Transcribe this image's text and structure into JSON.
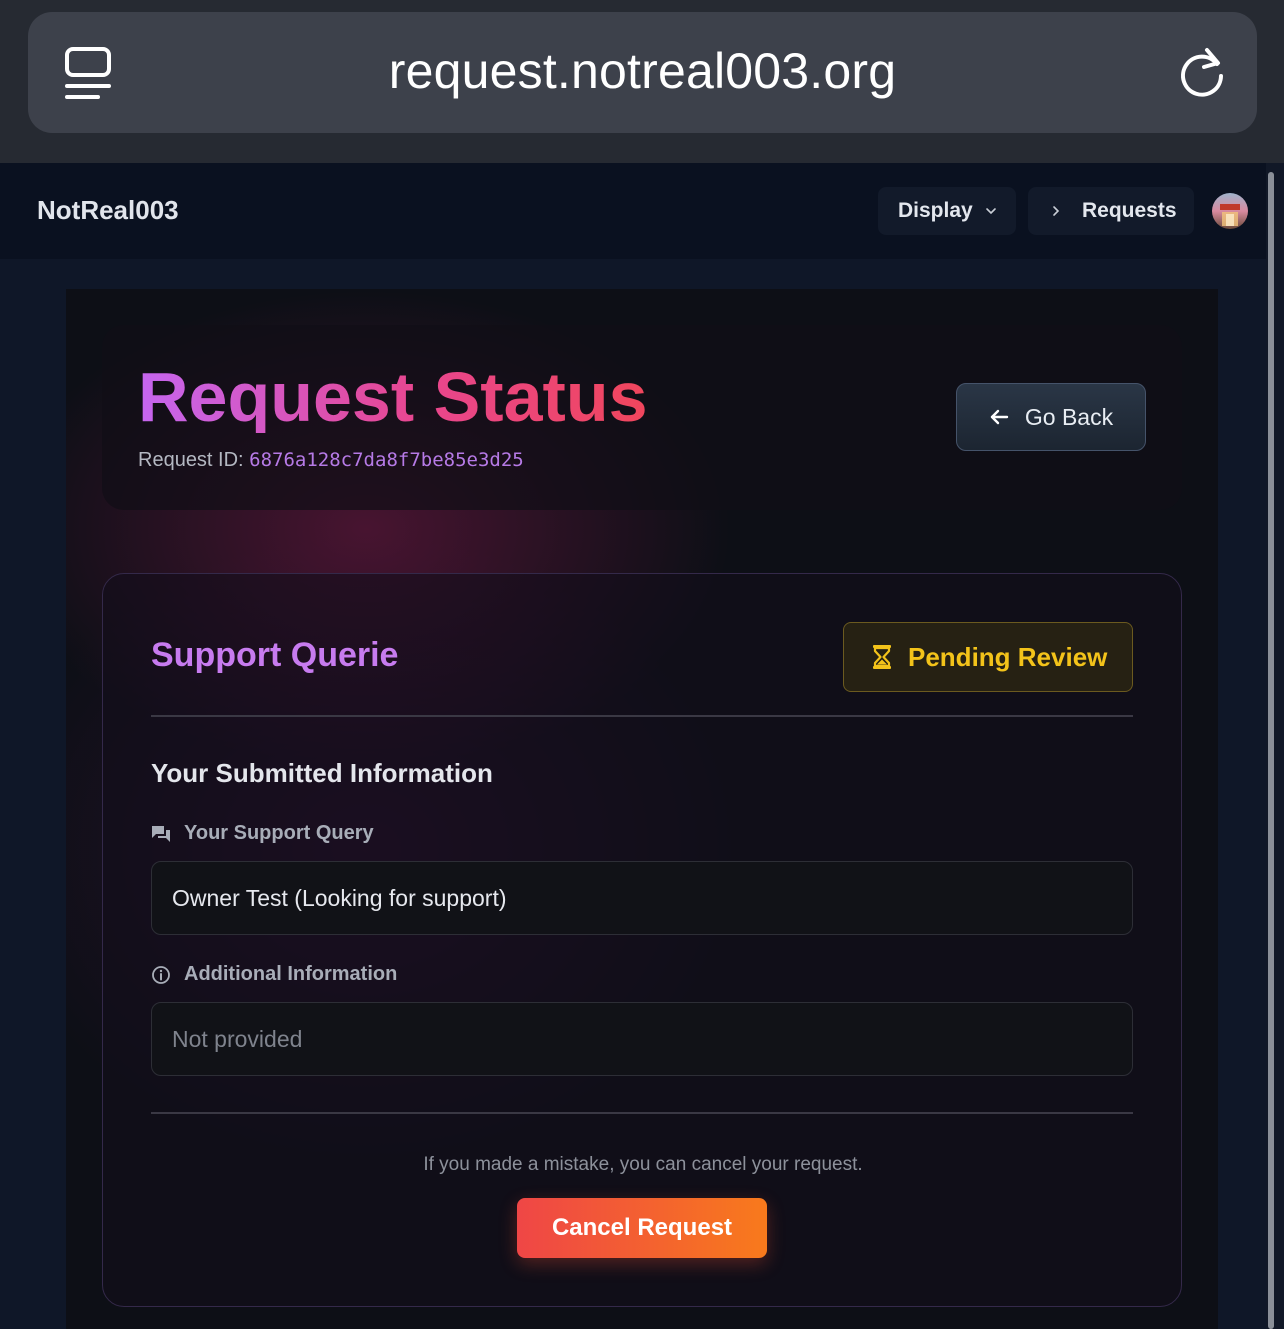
{
  "browser": {
    "url": "request.notreal003.org"
  },
  "nav": {
    "brand": "NotReal003",
    "display_label": "Display",
    "requests_label": "Requests"
  },
  "header": {
    "title": "Request Status",
    "request_id_label": "Request ID:",
    "request_id_value": "6876a128c7da8f7be85e3d25",
    "go_back_label": "Go Back"
  },
  "request": {
    "type_title": "Support Querie",
    "status": "Pending Review",
    "section_heading": "Your Submitted Information",
    "query_label": "Your Support Query",
    "query_value": "Owner Test (Looking for support)",
    "info_label": "Additional Information",
    "info_value": "Not provided",
    "cancel_note": "If you made a mistake, you can cancel your request.",
    "cancel_label": "Cancel Request"
  },
  "colors": {
    "accent_purple": "#c77bef",
    "status_pending": "#f3c31a",
    "cancel_start": "#ef4646",
    "cancel_end": "#f87a1c"
  }
}
